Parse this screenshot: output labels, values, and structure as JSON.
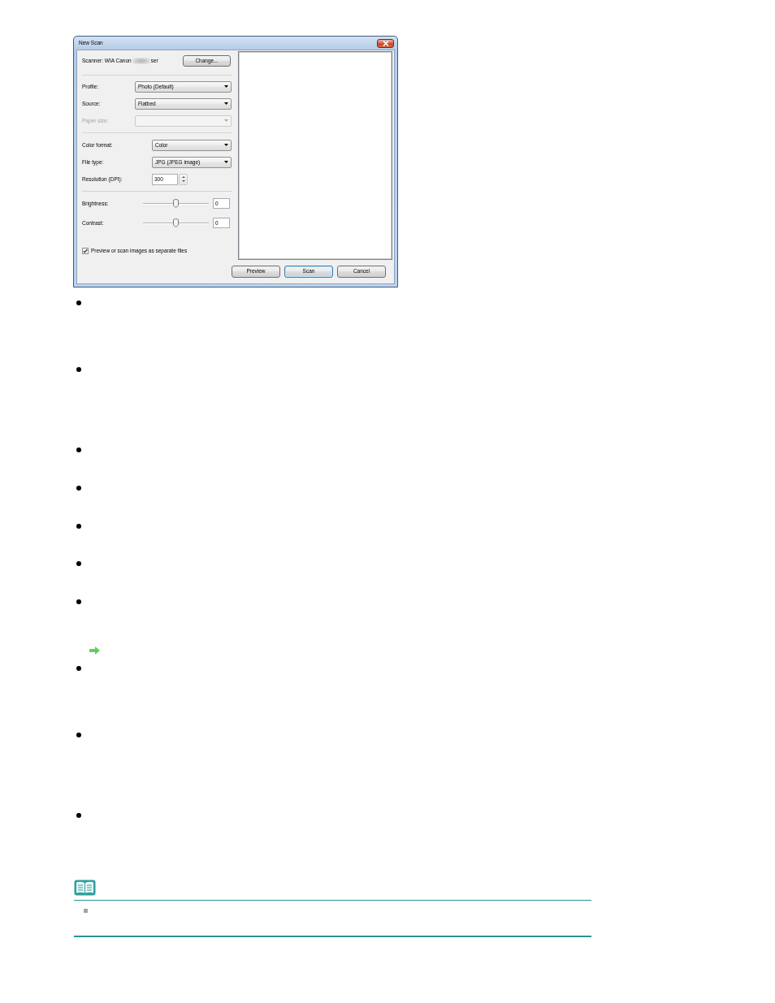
{
  "dialog": {
    "title": "New Scan",
    "scanner": {
      "label": "Scanner: WIA Canon",
      "name_blurred": true,
      "name_end": "ser"
    },
    "change_button": "Change...",
    "sections": [
      {
        "fields": [
          {
            "kind": "combo",
            "label": "Profile:",
            "value": "Photo (Default)",
            "disabled": false
          },
          {
            "kind": "combo",
            "label": "Source:",
            "value": "Flatbed",
            "disabled": false
          },
          {
            "kind": "combo",
            "label": "Paper size:",
            "disabled": true
          }
        ]
      },
      {
        "fields": [
          {
            "kind": "combo",
            "label": "Color format:",
            "value": "Color",
            "disabled": false
          },
          {
            "kind": "combo",
            "label": "File type:",
            "value": "JPG (JPEG image)",
            "disabled": false
          },
          {
            "kind": "spin",
            "label": "Resolution (DPI):",
            "value": "300",
            "disabled": false
          }
        ]
      },
      {
        "fields": [
          {
            "kind": "slider",
            "label": "Brightness:",
            "level": 0.5,
            "value": "0",
            "disabled": false
          },
          {
            "kind": "slider",
            "label": "Contrast:",
            "level": 0.5,
            "value": "0",
            "disabled": false
          }
        ]
      }
    ],
    "checkbox": {
      "label": "Preview or scan images as separate files",
      "checked": true
    },
    "buttons": [
      {
        "label": "Preview",
        "default": false
      },
      {
        "label": "Scan",
        "default": true
      },
      {
        "label": "Cancel",
        "default": false
      }
    ]
  },
  "content": {
    "items": [
      {
        "kind": "bullet"
      },
      {
        "kind": "bullet"
      },
      {
        "kind": "bullet"
      },
      {
        "kind": "bullet"
      },
      {
        "kind": "bullet"
      },
      {
        "kind": "bullet"
      },
      {
        "kind": "bullet"
      },
      {
        "kind": "link_arrow"
      },
      {
        "kind": "bullet"
      },
      {
        "kind": "bullet"
      },
      {
        "kind": "bullet"
      }
    ]
  },
  "note": {
    "items": [
      {
        "kind": "square_bullet"
      }
    ]
  }
}
